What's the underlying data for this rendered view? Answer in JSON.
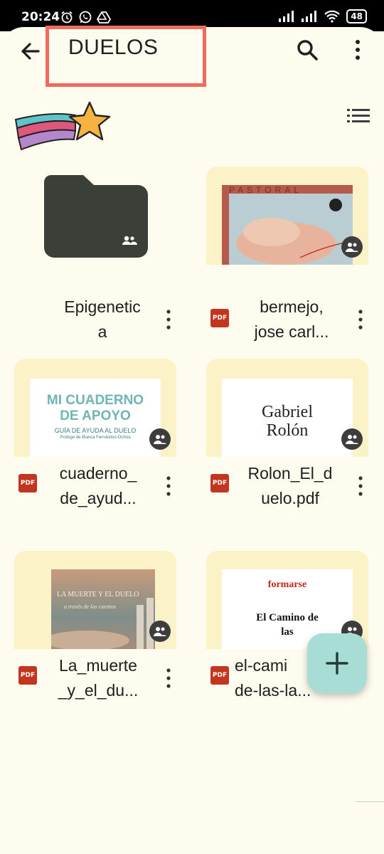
{
  "status_bar": {
    "time": "20:24",
    "battery": "48"
  },
  "header": {
    "title": "DUELOS"
  },
  "files": [
    {
      "name": "Epigenetic\na",
      "type": "folder",
      "shared": true
    },
    {
      "name": "bermejo,\njose carl...",
      "type": "pdf",
      "shared": true,
      "thumb_text": "PASTORAL"
    },
    {
      "name": "cuaderno_\nde_ayud...",
      "type": "pdf",
      "shared": true,
      "thumb_title": "MI CUADERNO\nDE APOYO",
      "thumb_subtitle": "GUÍA DE AYUDA AL DUELO",
      "thumb_credit": "Prólogo de Blanca Fernández-Ochoa"
    },
    {
      "name": "Rolon_El_d\nuelo.pdf",
      "type": "pdf",
      "shared": true,
      "thumb_title": "Gabriel\nRolón"
    },
    {
      "name": "La_muerte\n_y_el_du...",
      "type": "pdf",
      "shared": true,
      "thumb_title": "LA MUERTE Y EL DUELO",
      "thumb_subtitle": "a través de los cuentos"
    },
    {
      "name": "el-cami\nde-las-la...",
      "type": "pdf",
      "shared": true,
      "thumb_brand": "formarse",
      "thumb_title": "El Camino de\nlas"
    }
  ],
  "labels": {
    "pdf": "PDF"
  },
  "colors": {
    "accent_highlight": "#ef6b60",
    "card_bg": "#fcf2c7",
    "folder": "#3a3f37",
    "pdf_red": "#c4351f",
    "fab": "#a8ddd6"
  }
}
